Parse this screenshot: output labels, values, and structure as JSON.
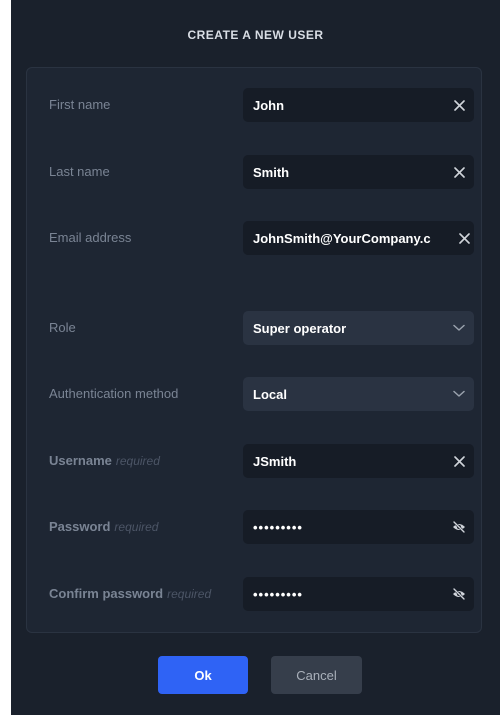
{
  "dialog": {
    "title": "CREATE A NEW USER"
  },
  "form": {
    "first_name": {
      "label": "First name",
      "value": "John"
    },
    "last_name": {
      "label": "Last name",
      "value": "Smith"
    },
    "email": {
      "label": "Email address",
      "value": "JohnSmith@YourCompany.c"
    },
    "role": {
      "label": "Role",
      "selected": "Super operator"
    },
    "auth_method": {
      "label": "Authentication method",
      "selected": "Local"
    },
    "username": {
      "label": "Username",
      "required": "required",
      "value": "JSmith"
    },
    "password": {
      "label": "Password",
      "required": "required",
      "value": "•••••••••"
    },
    "confirm_password": {
      "label": "Confirm password",
      "required": "required",
      "value": "•••••••••"
    }
  },
  "actions": {
    "ok_label": "Ok",
    "cancel_label": "Cancel"
  },
  "icons": {
    "clear": "close-icon",
    "dropdown": "chevron-down-icon",
    "visibility": "eye-off-icon"
  },
  "colors": {
    "background": "#1a212c",
    "panel": "#1e2633",
    "primary": "#2f63f5"
  }
}
